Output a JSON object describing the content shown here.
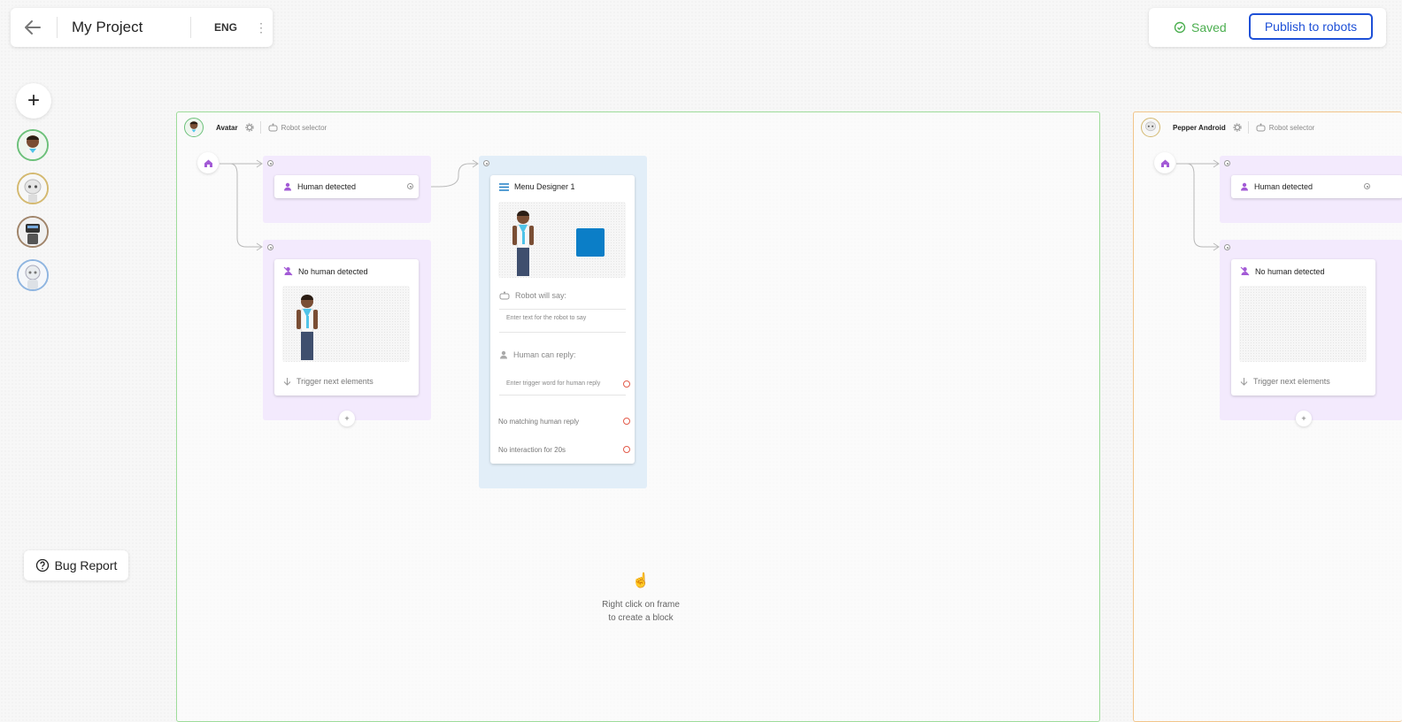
{
  "header": {
    "project_title": "My Project",
    "language": "ENG",
    "saved_label": "Saved",
    "publish_label": "Publish to robots"
  },
  "sidebar": {
    "add_symbol": "+",
    "robots": [
      {
        "name": "avatar",
        "ring": "#6cc07a"
      },
      {
        "name": "pepper",
        "ring": "#d4b970"
      },
      {
        "name": "dark-robot",
        "ring": "#a0846a"
      },
      {
        "name": "nao",
        "ring": "#8fb5e0"
      }
    ]
  },
  "bug_report": {
    "label": "Bug Report"
  },
  "colors": {
    "frame_green": "#9edc9a",
    "frame_orange": "#f2c58a",
    "accent_purple": "#a35bd6",
    "publish_blue": "#1e50d7",
    "saved_green": "#4caf50"
  },
  "frames": {
    "left": {
      "name": "Avatar",
      "selector": "Robot selector",
      "human_detected": "Human detected",
      "no_human_detected": "No human detected",
      "trigger_next": "Trigger next elements",
      "menu": {
        "title": "Menu Designer 1",
        "robot_will_say": "Robot will say:",
        "robot_placeholder": "Enter text for the robot to say",
        "human_can_reply": "Human can reply:",
        "human_placeholder": "Enter trigger word for human reply",
        "no_matching": "No matching human reply",
        "no_interaction": "No interaction for 20s"
      },
      "hint_icon": "☝",
      "hint_line1": "Right click on frame",
      "hint_line2": "to create a block"
    },
    "right": {
      "name": "Pepper Android",
      "selector": "Robot selector",
      "human_detected": "Human detected",
      "no_human_detected": "No human detected",
      "trigger_next": "Trigger next elements"
    }
  }
}
